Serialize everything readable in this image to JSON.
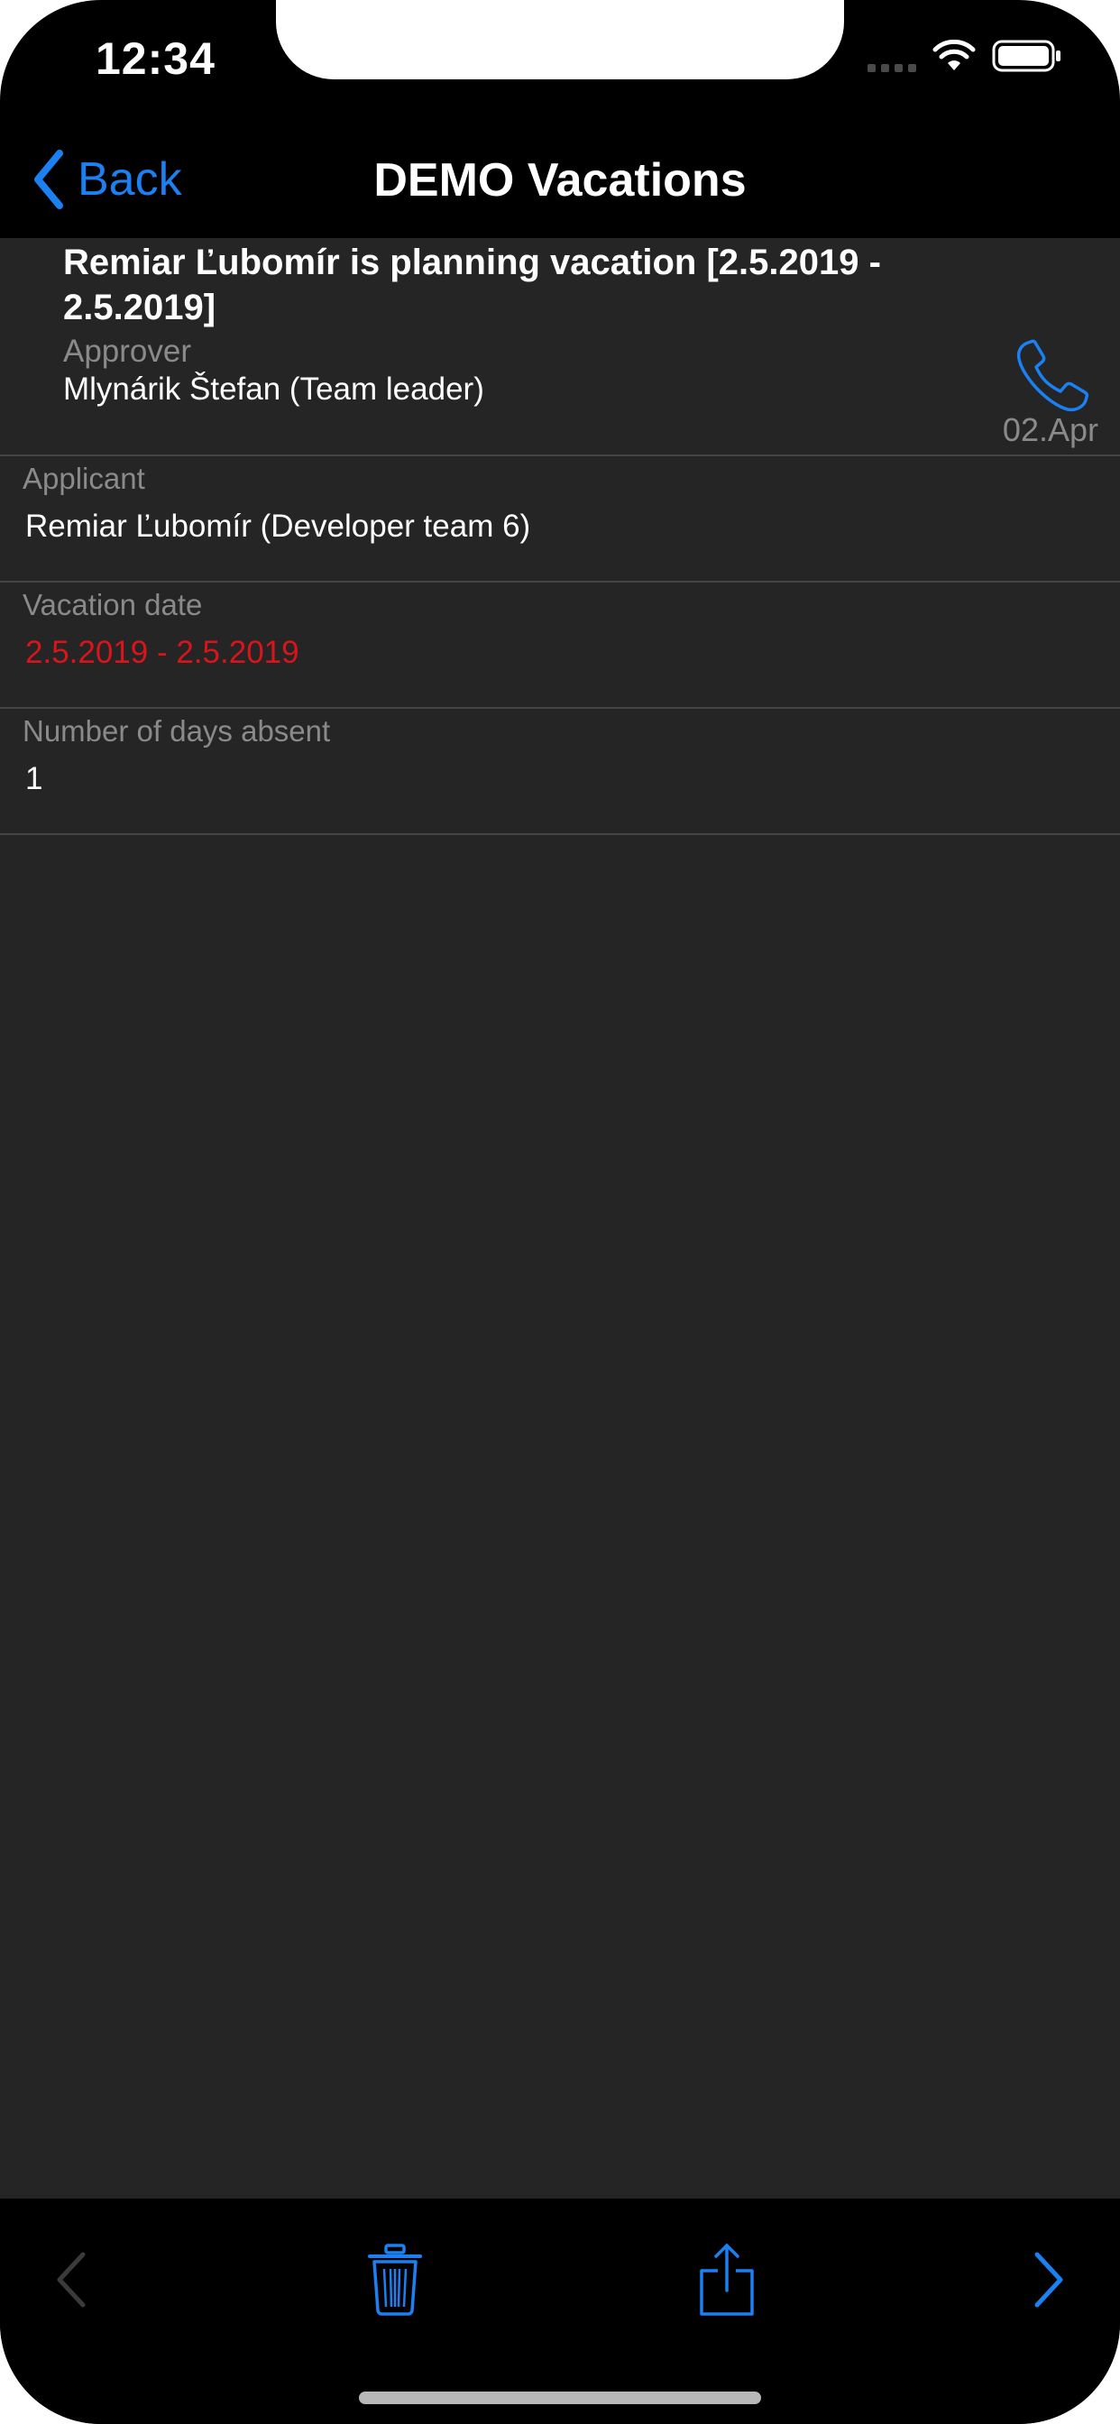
{
  "status_bar": {
    "time": "12:34"
  },
  "navbar": {
    "back_label": "Back",
    "title": "DEMO Vacations"
  },
  "header": {
    "title": "Remiar Ľubomír is planning vacation [2.5.2019 - 2.5.2019]",
    "approver_label": "Approver",
    "approver_value": "Mlynárik Štefan (Team leader)",
    "date": "02.Apr"
  },
  "fields": [
    {
      "label": "Applicant",
      "value": "Remiar Ľubomír (Developer team 6)"
    },
    {
      "label": "Vacation date",
      "value": "2.5.2019 - 2.5.2019"
    },
    {
      "label": "Number of days absent",
      "value": "1"
    }
  ],
  "colors": {
    "accent": "#1b80f2",
    "alert": "#d9141b",
    "content_bg": "#252525",
    "bar_bg": "#000000"
  },
  "toolbar": {
    "icons": [
      "chevron-left-icon",
      "trash-icon",
      "share-icon",
      "chevron-right-icon"
    ]
  }
}
